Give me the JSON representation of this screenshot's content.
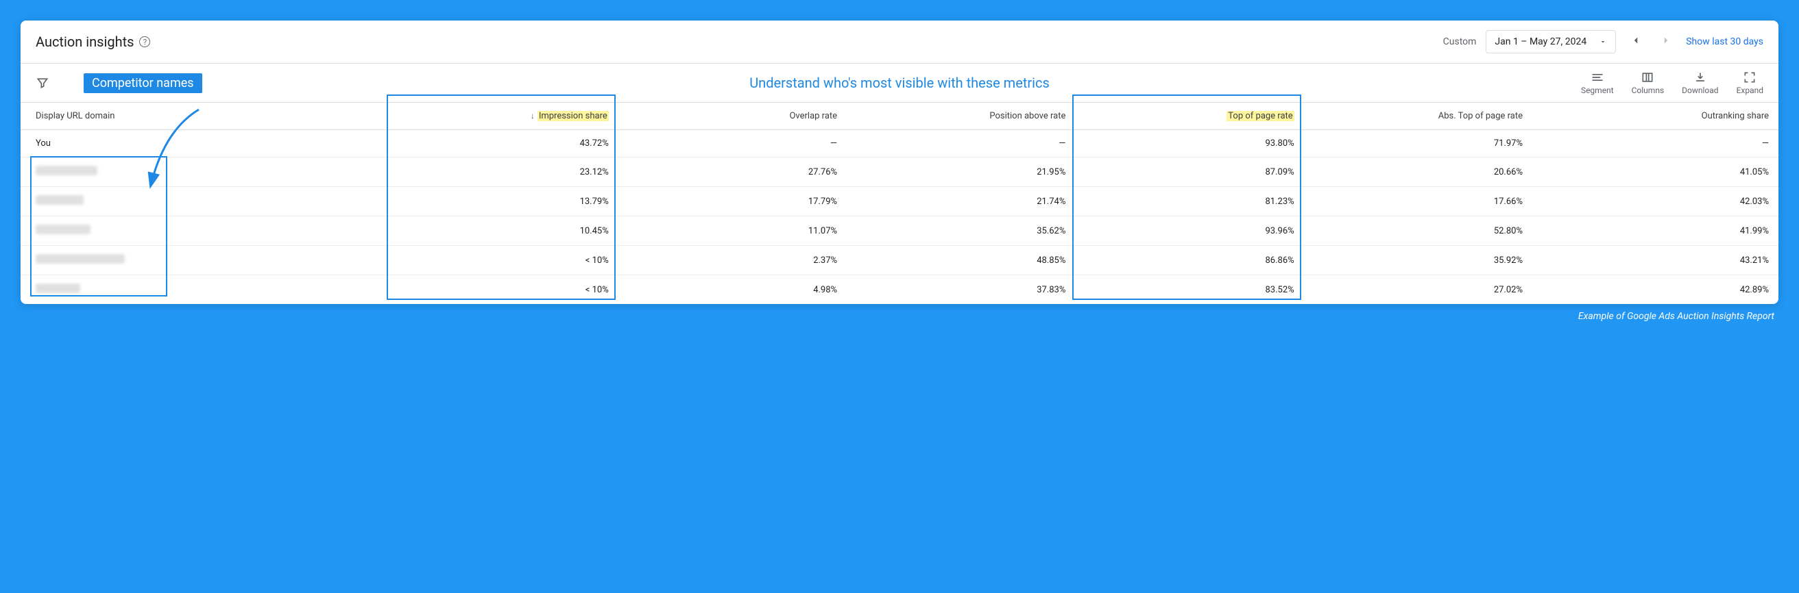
{
  "header": {
    "title": "Auction insights",
    "custom_label": "Custom",
    "date_range": "Jan 1 – May 27, 2024",
    "show_last": "Show last 30 days"
  },
  "annotations": {
    "competitor_badge": "Competitor names",
    "center_text": "Understand who's most visible with these metrics",
    "caption": "Example of Google Ads Auction Insights Report"
  },
  "toolbar": {
    "segment": "Segment",
    "columns": "Columns",
    "download": "Download",
    "expand": "Expand"
  },
  "table": {
    "headers": {
      "domain": "Display URL domain",
      "impression": "Impression share",
      "overlap": "Overlap rate",
      "position_above": "Position above rate",
      "top_of_page": "Top of page rate",
      "abs_top": "Abs. Top of page rate",
      "outranking": "Outranking share"
    },
    "rows": [
      {
        "domain": "You",
        "impression": "43.72%",
        "overlap": "—",
        "position_above": "—",
        "top_of_page": "93.80%",
        "abs_top": "71.97%",
        "outranking": "—"
      },
      {
        "domain": "",
        "impression": "23.12%",
        "overlap": "27.76%",
        "position_above": "21.95%",
        "top_of_page": "87.09%",
        "abs_top": "20.66%",
        "outranking": "41.05%"
      },
      {
        "domain": "",
        "impression": "13.79%",
        "overlap": "17.79%",
        "position_above": "21.74%",
        "top_of_page": "81.23%",
        "abs_top": "17.66%",
        "outranking": "42.03%"
      },
      {
        "domain": "",
        "impression": "10.45%",
        "overlap": "11.07%",
        "position_above": "35.62%",
        "top_of_page": "93.96%",
        "abs_top": "52.80%",
        "outranking": "41.99%"
      },
      {
        "domain": "",
        "impression": "< 10%",
        "overlap": "2.37%",
        "position_above": "48.85%",
        "top_of_page": "86.86%",
        "abs_top": "35.92%",
        "outranking": "43.21%"
      },
      {
        "domain": "",
        "impression": "< 10%",
        "overlap": "4.98%",
        "position_above": "37.83%",
        "top_of_page": "83.52%",
        "abs_top": "27.02%",
        "outranking": "42.89%"
      }
    ]
  }
}
